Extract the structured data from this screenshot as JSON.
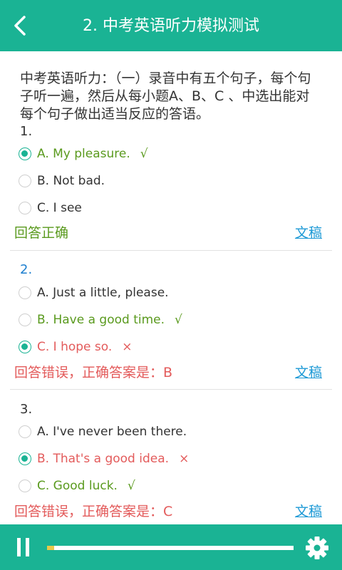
{
  "header": {
    "title": "2. 中考英语听力模拟测试"
  },
  "intro": "中考英语听力：（一）录音中有五个句子，每个句子听一遍，然后从每小题A、B、C 、中选出能对每个句子做出适当反应的答语。",
  "questions": [
    {
      "number": "1.",
      "options": [
        {
          "text": "A. My pleasure.",
          "mark": "√",
          "state": "correct-selected"
        },
        {
          "text": "B. Not bad.",
          "mark": "",
          "state": "normal"
        },
        {
          "text": "C. I see",
          "mark": "",
          "state": "normal"
        }
      ],
      "result": "回答正确",
      "link": "文稿"
    },
    {
      "number": "2.",
      "options": [
        {
          "text": "A. Just a little, please.",
          "mark": "",
          "state": "normal"
        },
        {
          "text": "B. Have a good time.",
          "mark": "√",
          "state": "correct"
        },
        {
          "text": "C. I hope so.",
          "mark": "×",
          "state": "wrong-selected"
        }
      ],
      "result": "回答错误，正确答案是：B",
      "link": "文稿"
    },
    {
      "number": "3.",
      "options": [
        {
          "text": "A. I've never been there.",
          "mark": "",
          "state": "normal"
        },
        {
          "text": "B. That's a good idea.",
          "mark": "×",
          "state": "wrong-selected"
        },
        {
          "text": "C. Good luck.",
          "mark": "√",
          "state": "correct"
        }
      ],
      "result": "回答错误，正确答案是：C",
      "link": "文稿"
    }
  ],
  "player": {
    "progress": 0.03
  },
  "colors": {
    "accent": "#1ab394",
    "correct": "#5a9a1e",
    "wrong": "#e35b5b",
    "link": "#1e9ad6",
    "progress_fill": "#e8c94a"
  },
  "icons": {
    "back": "chevron-left-icon",
    "pause": "pause-icon",
    "settings": "gear-icon"
  }
}
